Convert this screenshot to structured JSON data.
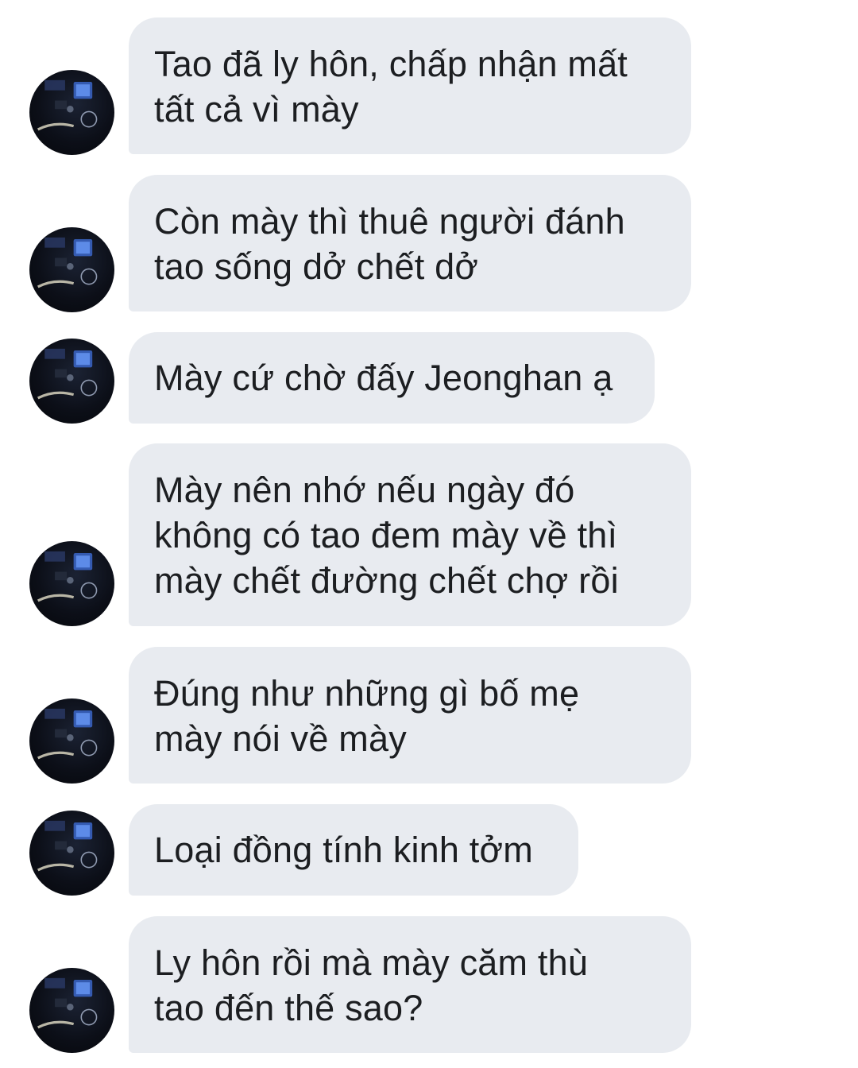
{
  "conversation": {
    "messages": [
      {
        "text": "Tao đã ly hôn, chấp nhận mất\ntất cả vì mày"
      },
      {
        "text": "Còn mày thì thuê người đánh\ntao sống dở chết dở"
      },
      {
        "text": "Mày cứ chờ đấy Jeonghan ạ"
      },
      {
        "text": "Mày nên nhớ nếu ngày đó\nkhông có tao đem mày về thì\nmày chết đường chết chợ rồi"
      },
      {
        "text": "Đúng như những gì bố mẹ\nmày nói về mày"
      },
      {
        "text": "Loại đồng tính kinh tởm"
      },
      {
        "text": "Ly hôn rồi mà mày căm thù\ntao đến thế sao?"
      }
    ],
    "avatar_icon": "car-dashboard-avatar",
    "bubble_color": "#e8ebf0",
    "text_color": "#1c1e21"
  }
}
